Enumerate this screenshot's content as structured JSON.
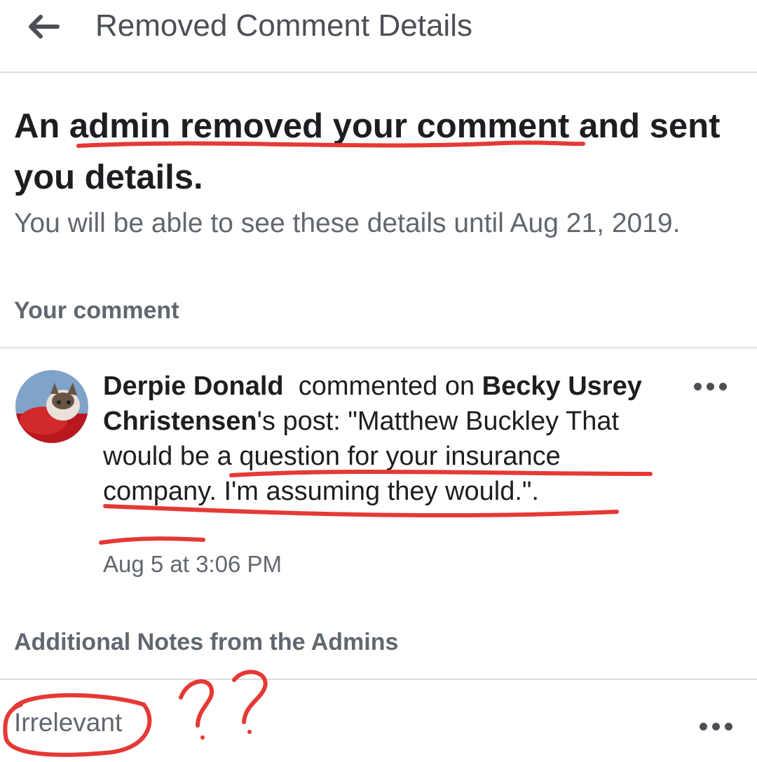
{
  "header": {
    "title": "Removed Comment Details",
    "back_icon": "arrow-left-icon"
  },
  "notice": {
    "headline": "An admin removed your comment and sent you details.",
    "availability": "You will be able to see these details until Aug 21, 2019."
  },
  "your_comment": {
    "section_label": "Your comment",
    "author": "Derpie Donald",
    "action": "commented on",
    "post_owner": "Becky Usrey Christensen",
    "post_suffix": "'s post:",
    "body": "\"Matthew Buckley That would be a question for your insurance company.  I'm assuming they would.\".",
    "timestamp": "Aug 5 at 3:06 PM",
    "menu_icon": "more-horizontal-icon"
  },
  "admin_notes": {
    "section_label": "Additional Notes from the Admins",
    "note": "Irrelevant",
    "menu_icon": "more-horizontal-icon"
  },
  "annotations": {
    "color": "#e53935",
    "marks": "??"
  }
}
